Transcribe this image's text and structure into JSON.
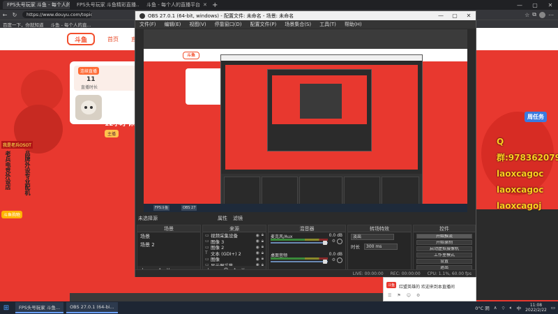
{
  "browser": {
    "tabs": [
      {
        "label": "FPS头号玩家 斗鱼 - 每个人的直播平台",
        "active": true
      },
      {
        "label": "FPS头号玩家 斗鱼精彩直播...",
        "active": false
      },
      {
        "label": "斗鱼 - 每个人的直播平台",
        "active": false
      }
    ],
    "new_tab": "+",
    "url": "https://www.douyu.com/topic/FPSdnz",
    "bookmarks": [
      "百度一下，你就知道",
      "斗鱼 - 每个人的直..."
    ]
  },
  "site": {
    "logo_text": "斗鱼",
    "nav": [
      "首页",
      "直播"
    ],
    "sub_badge": "连续直播",
    "sub_count": "11",
    "sub_label": "直播时长",
    "stream_title": "12小时 休息了",
    "stream_badge": "主播",
    "left_banner": {
      "top": "我是老兵OSOT",
      "col1": "老兵电竞外设店",
      "col2": "品牌外设专业配机",
      "bottom": "斗鱼购物"
    },
    "gift_tag": "周任务",
    "overlay_lines": [
      "Q群:978362079",
      "laoxcagoc",
      "laoxcagoc",
      "laoxcagoj"
    ]
  },
  "obs": {
    "title": "OBS 27.0.1 (64-bit, windows) - 配置文件: 未命名 - 场景: 未命名",
    "menu": [
      "文件(F)",
      "编辑(E)",
      "视图(V)",
      "停靠窗口(D)",
      "配置文件(P)",
      "场景集合(S)",
      "工具(T)",
      "帮助(H)"
    ],
    "no_source": "未选择源",
    "props": "属性",
    "filters": "滤镜",
    "docks": {
      "scenes": {
        "title": "场景",
        "items": [
          "场景",
          "场景 2"
        ]
      },
      "sources": {
        "title": "来源",
        "items": [
          {
            "icon": "▭",
            "label": "视频采集设备"
          },
          {
            "icon": "▭",
            "label": "图像 3"
          },
          {
            "icon": "▭",
            "label": "图像 2"
          },
          {
            "icon": "T",
            "label": "文本 (GDI+) 2"
          },
          {
            "icon": "▭",
            "label": "图像"
          },
          {
            "icon": "▭",
            "label": "显示器采集"
          }
        ]
      },
      "mixer": {
        "title": "混音器",
        "items": [
          {
            "name": "桌面音频",
            "db": "0.0 dB"
          },
          {
            "name": "麦克风/Aux",
            "db": "0.0 dB"
          }
        ]
      },
      "transitions": {
        "title": "转场特效",
        "type": "淡出",
        "duration_label": "时长",
        "duration_value": "300 ms"
      },
      "controls": {
        "title": "控件",
        "buttons": [
          "开始推流",
          "开始录制",
          "启动虚拟摄像机",
          "工作室模式",
          "设置",
          "退出"
        ]
      }
    },
    "status": [
      "LIVE: 00:00:00",
      "REC: 00:00:00",
      "CPU: 1.1%, 60.00 fps"
    ]
  },
  "notification": {
    "badge": "斗鱼",
    "text": "红盟英雄的 欢迎来到本直播间"
  },
  "taskbar": {
    "start": "⊞",
    "apps": [
      "FPS头号玩家 斗鱼...",
      "OBS 27.0.1 (64-bi..."
    ],
    "weather": "0°C 阴",
    "lang": "中",
    "time": "11:08",
    "date": "2022/2/22"
  }
}
